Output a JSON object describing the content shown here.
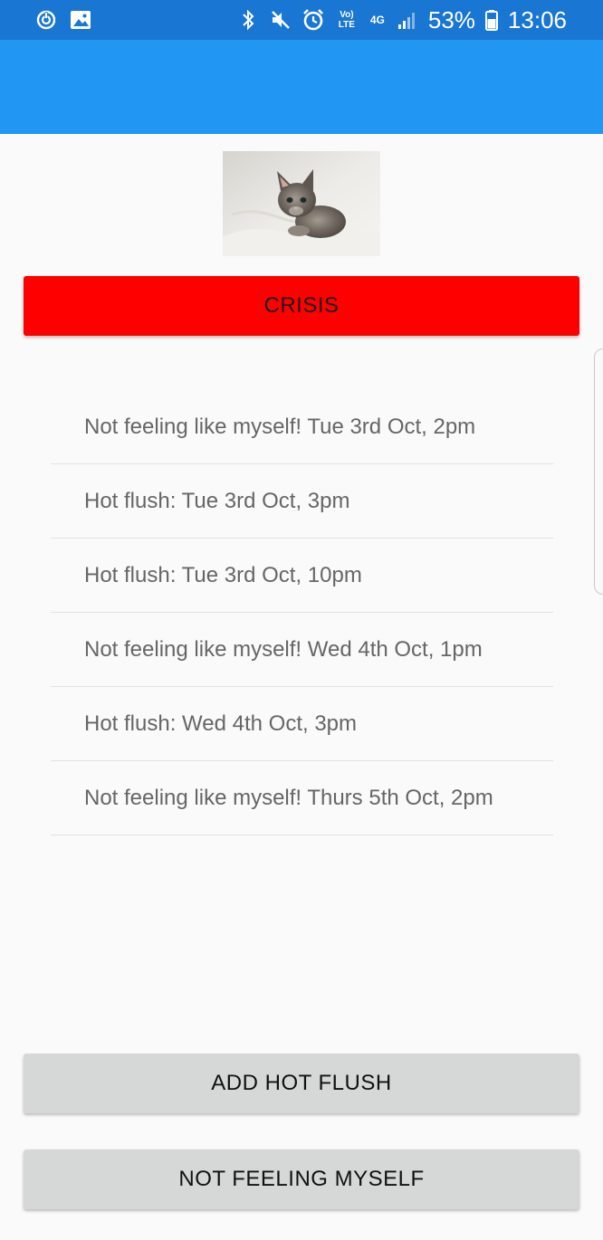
{
  "status_bar": {
    "battery_percent": "53%",
    "time": "13:06",
    "network_label": "4G",
    "lte_label": "Vo) LTE",
    "icons": [
      "sync-icon",
      "image-icon",
      "bluetooth-icon",
      "mute-icon",
      "alarm-icon",
      "volte-icon",
      "network-4g-icon",
      "signal-icon",
      "battery-icon"
    ]
  },
  "colors": {
    "status_bar": "#1976d2",
    "app_bar": "#2196f3",
    "crisis": "#ff0000",
    "button_gray": "#d6d7d7"
  },
  "crisis_button": {
    "label": "CRISIS"
  },
  "entries": [
    {
      "text": "Not feeling like myself! Tue 3rd Oct, 2pm"
    },
    {
      "text": "Hot flush: Tue 3rd Oct, 3pm"
    },
    {
      "text": "Hot flush: Tue 3rd Oct, 10pm"
    },
    {
      "text": "Not feeling like myself! Wed 4th Oct, 1pm"
    },
    {
      "text": "Hot flush: Wed 4th Oct, 3pm"
    },
    {
      "text": "Not feeling like myself! Thurs 5th Oct, 2pm"
    }
  ],
  "actions": {
    "add_hot_flush": "ADD HOT FLUSH",
    "not_feeling_myself": "NOT FEELING MYSELF"
  }
}
